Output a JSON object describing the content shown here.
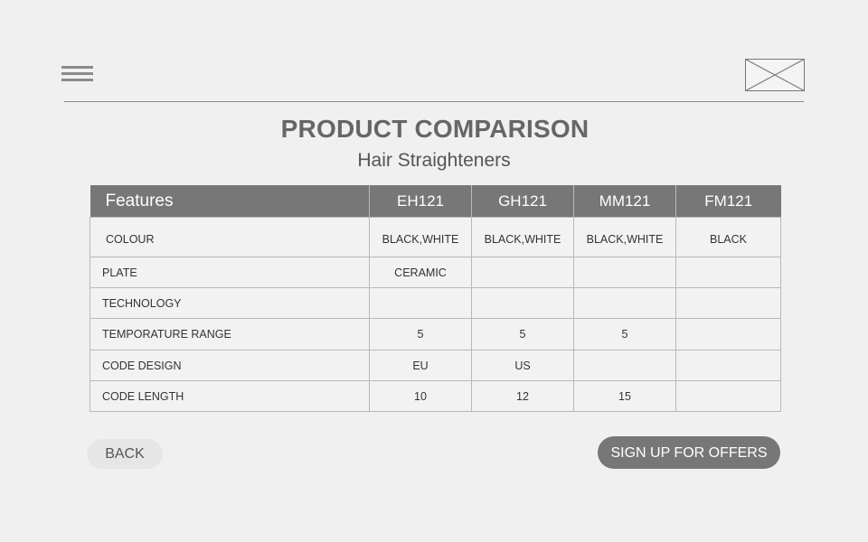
{
  "header": {
    "menu_icon": "hamburger-menu-icon",
    "logo_icon": "image-placeholder-icon"
  },
  "page": {
    "title": "PRODUCT COMPARISON",
    "subtitle": "Hair Straighteners"
  },
  "table": {
    "columns": [
      "Features",
      "EH121",
      "GH121",
      "MM121",
      "FM121"
    ],
    "rows": [
      {
        "feature": "COLOUR",
        "values": [
          "BLACK,WHITE",
          "BLACK,WHITE",
          "BLACK,WHITE",
          "BLACK"
        ]
      },
      {
        "feature": "PLATE",
        "values": [
          "CERAMIC",
          "",
          "",
          ""
        ]
      },
      {
        "feature": "TECHNOLOGY",
        "values": [
          "",
          "",
          "",
          ""
        ]
      },
      {
        "feature": "TEMPORATURE RANGE",
        "values": [
          "5",
          "5",
          "5",
          ""
        ]
      },
      {
        "feature": "CODE DESIGN",
        "values": [
          "EU",
          "US",
          "",
          ""
        ]
      },
      {
        "feature": "CODE LENGTH",
        "values": [
          "10",
          "12",
          "15",
          ""
        ]
      }
    ]
  },
  "actions": {
    "back_label": "BACK",
    "signup_label": "SIGN UP FOR OFFERS"
  },
  "colors": {
    "background": "#f0f0f0",
    "header_fill": "#777777",
    "button_primary": "#777777",
    "button_secondary": "#e6e6e6"
  }
}
